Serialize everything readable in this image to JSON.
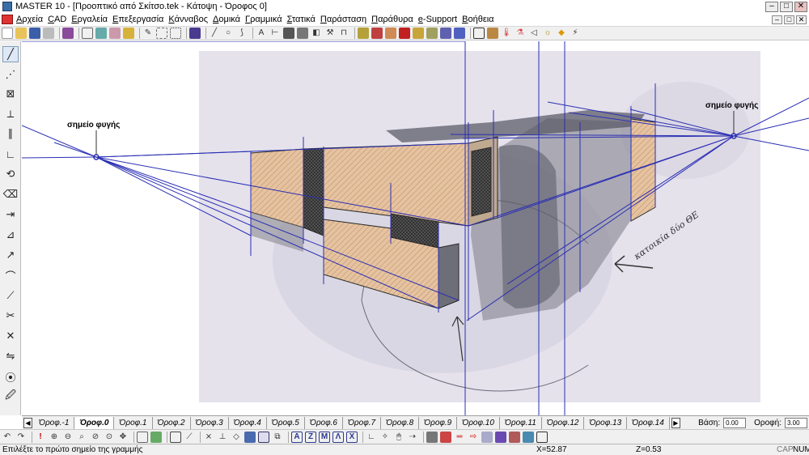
{
  "window": {
    "title": "MASTER 10 - [Προοπτικό από Σκίτσο.tek - Κάτοψη - Όροφος 0]"
  },
  "window_controls": {
    "minimize": "–",
    "maximize": "□",
    "close": "✕"
  },
  "menu": {
    "items": [
      "Αρχεία",
      "CAD",
      "Εργαλεία",
      "Επεξεργασία",
      "Κάνναβος",
      "Δομικά",
      "Γραμμικά",
      "Στατικά",
      "Παράσταση",
      "Παράθυρα",
      "e-Support",
      "Βοήθεια"
    ]
  },
  "canvas": {
    "annotation_left": "σημείο φυγής",
    "annotation_right": "σημείο φυγής",
    "sketch_note": "κατοικία δύο ΘΕ"
  },
  "floor_tabs": {
    "tabs": [
      "Όροφ.-1",
      "Όροφ.0",
      "Όροφ.1",
      "Όροφ.2",
      "Όροφ.3",
      "Όροφ.4",
      "Όροφ.5",
      "Όροφ.6",
      "Όροφ.7",
      "Όροφ.8",
      "Όροφ.9",
      "Όροφ.10",
      "Όροφ.11",
      "Όροφ.12",
      "Όροφ.13",
      "Όροφ.14"
    ],
    "active_index": 1,
    "base_label": "Βάση:",
    "base_value": "0.00",
    "floor_label": "Οροφή:",
    "floor_value": "3.00"
  },
  "status": {
    "message": "Επιλέξτε το πρώτο σημείο της γραμμής",
    "x": "X=52.87",
    "z": "Z=0.53",
    "caps": "CAP",
    "num": "NUM"
  }
}
